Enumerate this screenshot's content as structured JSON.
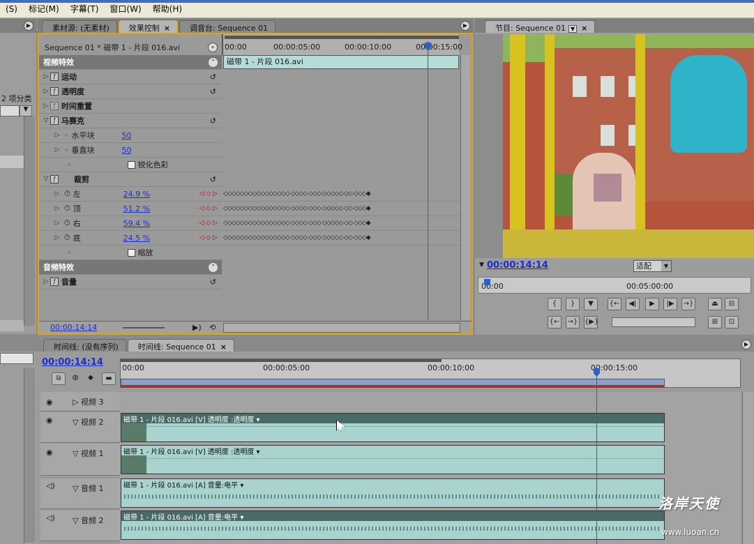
{
  "menu": [
    "(S)",
    "标记(M)",
    "字幕(T)",
    "窗口(W)",
    "帮助(H)"
  ],
  "colors": {
    "accent_border": "#e8a300",
    "playhead": "#e02020",
    "clip": "#a9d3ce",
    "clip_header": "#4a6a66",
    "timecode": "#1a2fcc"
  },
  "left_panel": {
    "label": "2 项分类"
  },
  "top_tabs": {
    "source": "素材源: (无素材)",
    "effect_controls": "效果控制",
    "mixer": "调音台: Sequence 01"
  },
  "effect_controls": {
    "header": "Sequence 01 * 磁带 1 - 片段 016.avi",
    "ruler": [
      "00:00",
      "00:00:05:00",
      "00:00:10:00",
      "00:00:15:00"
    ],
    "clip_label": "磁带 1 - 片段 016.avi",
    "video_effects": "视频特效",
    "rows": {
      "motion": "运动",
      "opacity": "透明度",
      "time_remap": "时间重置",
      "mosaic": "马赛克",
      "h_blocks": "水平块",
      "h_blocks_val": "50",
      "v_blocks": "垂直块",
      "v_blocks_val": "50",
      "sharpen": "锐化色彩",
      "crop": "裁剪",
      "left": "左",
      "left_val": "24.9 %",
      "top": "顶",
      "top_val": "51.2 %",
      "right": "右",
      "right_val": "59.4 %",
      "bottom": "底",
      "bottom_val": "24.5 %",
      "zoom": "缩放"
    },
    "audio_effects": "音频特效",
    "volume": "音量",
    "timecode": "00:00:14:14",
    "keyframes": "◇◇◇◇◇◇◇◇◇◇◇◇◇◇◇◇ ◇◇◇◇ ◇◇◇ ◇◇◇◇◇ ◇◇ ◇◇◇◆"
  },
  "program": {
    "tab": "节目: Sequence 01",
    "timecode": "00:00:14:14",
    "fit": "适配",
    "ruler": [
      "00:00",
      "00:05:00:00"
    ]
  },
  "timeline": {
    "tab1": "时间线: (没有序列)",
    "tab2": "时间线: Sequence 01",
    "timecode": "00:00:14:14",
    "ruler": [
      "00:00",
      "00:00:05:00",
      "00:00:10:00",
      "00:00:15:00"
    ],
    "tracks": {
      "v3": "视频 3",
      "v2": "视频 2",
      "v1": "视频 1",
      "a1": "音频 1",
      "a2": "音频 2"
    },
    "clips": {
      "v2": "磁带 1 - 片段 016.avi [V]  透明度 :透明度 ▾",
      "v1": "磁带 1 - 片段 016.avi [V]  透明度 :透明度 ▾",
      "a1": "磁带 1 - 片段 016.avi [A]  音量:电平 ▾",
      "a2": "磁带 1 - 片段 016.avi [A]  音量:电平 ▾"
    }
  },
  "watermark": {
    "logo": "洛岸天使",
    "url": "www.luoan.cn"
  }
}
